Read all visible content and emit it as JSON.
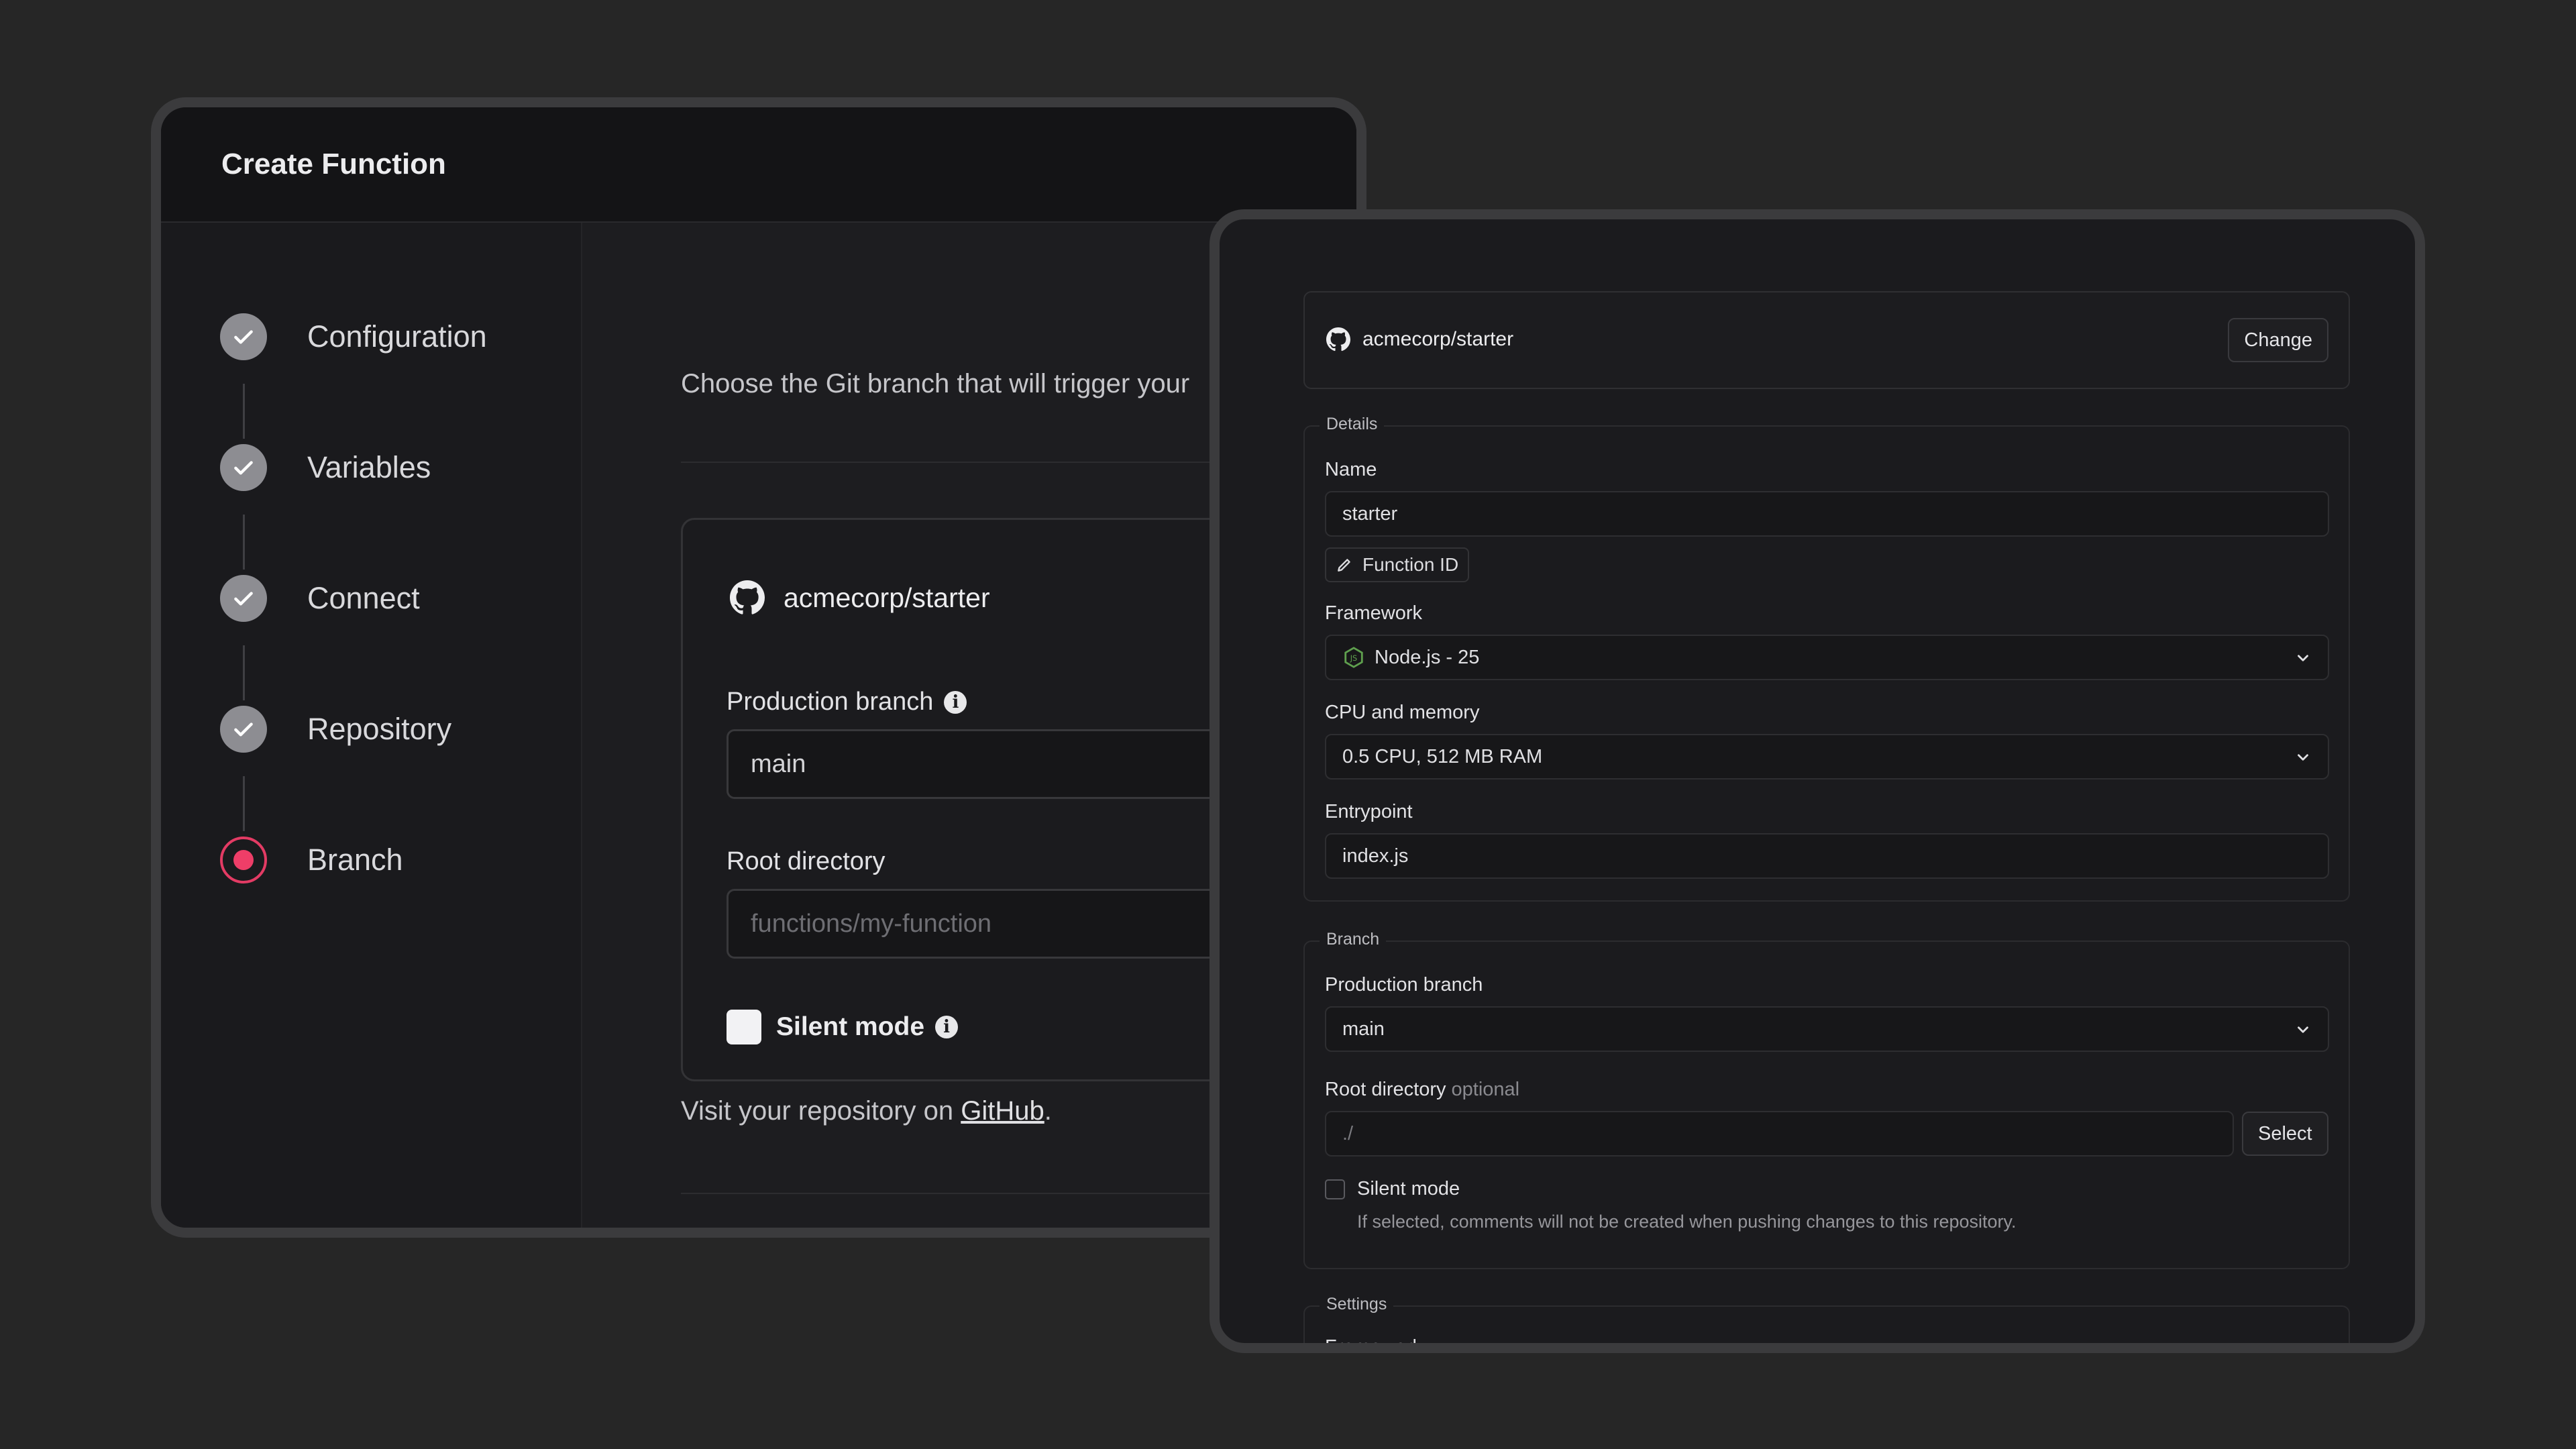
{
  "left_window": {
    "title": "Create Function",
    "steps": [
      {
        "label": "Configuration",
        "status": "done"
      },
      {
        "label": "Variables",
        "status": "done"
      },
      {
        "label": "Connect",
        "status": "done"
      },
      {
        "label": "Repository",
        "status": "done"
      },
      {
        "label": "Branch",
        "status": "active"
      }
    ],
    "lead_text": "Choose the Git branch that will trigger your",
    "repo_name": "acmecorp/starter",
    "production_branch_label": "Production branch",
    "production_branch_value": "main",
    "root_directory_label": "Root directory",
    "root_directory_placeholder": "functions/my-function",
    "silent_mode_label": "Silent mode",
    "visit_prefix": "Visit your repository on ",
    "visit_link": "GitHub",
    "visit_suffix": "."
  },
  "right_window": {
    "repo_name": "acmecorp/starter",
    "change_label": "Change",
    "details": {
      "legend": "Details",
      "name_label": "Name",
      "name_value": "starter",
      "function_id_label": "Function ID",
      "framework_label": "Framework",
      "framework_value": "Node.js - 25",
      "cpu_label": "CPU and memory",
      "cpu_value": "0.5 CPU, 512 MB RAM",
      "entrypoint_label": "Entrypoint",
      "entrypoint_value": "index.js"
    },
    "branch": {
      "legend": "Branch",
      "production_branch_label": "Production branch",
      "production_branch_value": "main",
      "root_directory_label": "Root directory",
      "root_directory_optional": "optional",
      "root_directory_placeholder": "./",
      "select_label": "Select",
      "silent_mode_label": "Silent mode",
      "silent_mode_hint": "If selected, comments will not be created when pushing changes to this repository."
    },
    "settings": {
      "legend": "Settings",
      "first_label": "Framework"
    }
  },
  "colors": {
    "background": "#262626",
    "accent": "#ee3e68",
    "step_done": "#8d8d92",
    "nodejs_green": "#5fa04e"
  },
  "icons": {
    "repo": "github-icon",
    "step_done": "check-icon",
    "info": "info-icon",
    "edit": "pencil-icon",
    "dropdown": "chevron-down-icon",
    "framework": "nodejs-icon"
  }
}
